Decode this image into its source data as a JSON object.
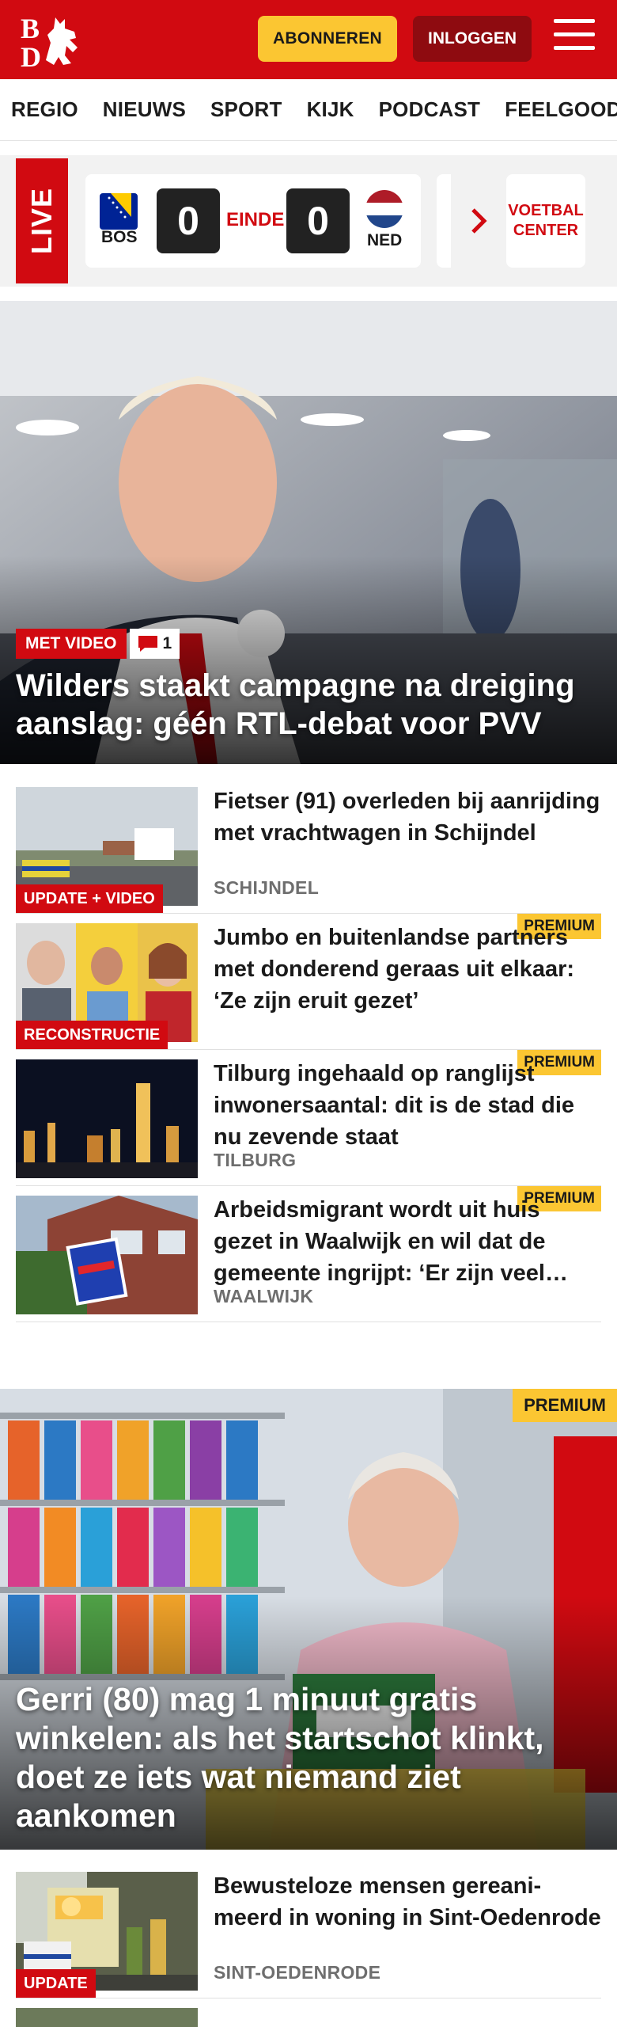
{
  "header": {
    "logo_text": "BD",
    "subscribe_label": "ABONNEREN",
    "login_label": "INLOGGEN",
    "brand_color": "#d10a11",
    "accent_color": "#fbc632"
  },
  "nav": {
    "items": [
      {
        "label": "REGIO"
      },
      {
        "label": "NIEUWS"
      },
      {
        "label": "SPORT"
      },
      {
        "label": "KIJK"
      },
      {
        "label": "PODCAST"
      },
      {
        "label": "FEELGOOD"
      }
    ]
  },
  "live": {
    "label": "LIVE",
    "match": {
      "home_team": "BOS",
      "home_score": "0",
      "status": "EINDE",
      "away_score": "0",
      "away_team": "NED"
    },
    "voetbal_center_line1": "VOETBAL",
    "voetbal_center_line2": "CENTER"
  },
  "hero": {
    "badge": "MET VIDEO",
    "comment_count": "1",
    "title": "Wilders staakt campagne na dreiging aanslag: géén RTL-debat voor PVV"
  },
  "articles": [
    {
      "title": "Fietser (91) overleden bij aanrijding met vrachtwagen in Schijndel",
      "location": "SCHIJNDEL",
      "label": "UPDATE + VIDEO",
      "premium": ""
    },
    {
      "title": "Jumbo en buitenlandse partners met donderend geraas uit elkaar: ‘Ze zijn eruit gezet’",
      "location": "",
      "label": "RECONSTRUCTIE",
      "premium": "PREMIUM"
    },
    {
      "title": "Tilburg ingehaald op ranglijst inwonersaantal: dit is de stad die nu zevende staat",
      "location": "TILBURG",
      "label": "",
      "premium": "PREMIUM"
    },
    {
      "title": "Arbeidsmigrant wordt uit huis gezet in Waalwijk en wil dat de gemeente ingrijpt: ‘Er zijn veel…",
      "location": "WAALWIJK",
      "label": "",
      "premium": "PREMIUM"
    }
  ],
  "feature": {
    "premium": "PREMIUM",
    "title": "Gerri (80) mag 1 minuut gratis winkelen: als het startschot klinkt, doet ze iets wat niemand ziet aankomen"
  },
  "articles_after": [
    {
      "title": "Bewusteloze mensen gereani­meerd in woning in Sint-Oedenrode",
      "location": "SINT-OEDENRODE",
      "label": "UPDATE",
      "premium": ""
    }
  ]
}
